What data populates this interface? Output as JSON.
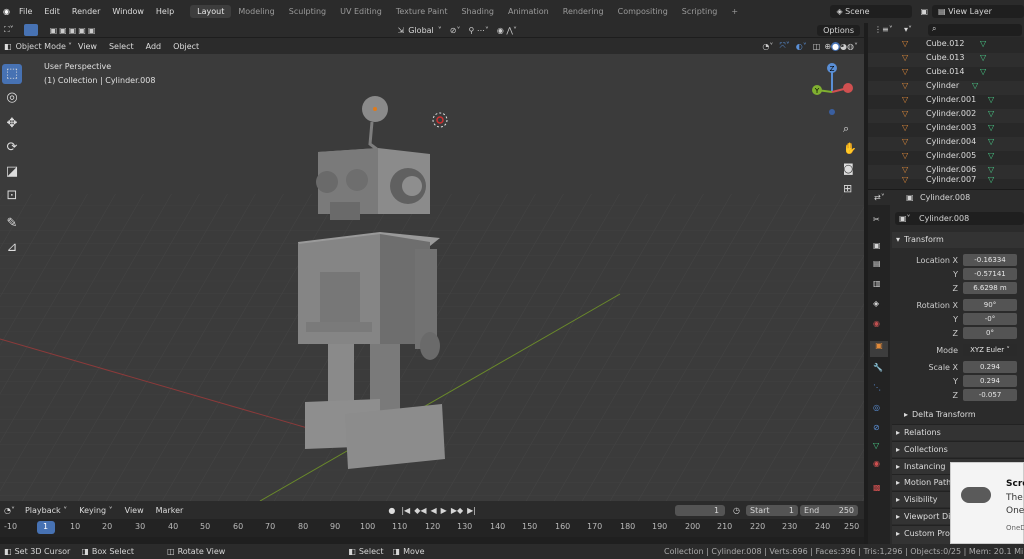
{
  "topbar": {
    "menus": [
      "File",
      "Edit",
      "Render",
      "Window",
      "Help"
    ],
    "workspaces": [
      "Layout",
      "Modeling",
      "Sculpting",
      "UV Editing",
      "Texture Paint",
      "Shading",
      "Animation",
      "Rendering",
      "Compositing",
      "Scripting"
    ],
    "active_workspace": "Layout",
    "add_tab": "+",
    "scene": "Scene",
    "view_layer": "View Layer"
  },
  "viewport_header": {
    "transform_orientation": "Global",
    "options": "Options",
    "mode": "Object Mode",
    "menus": [
      "View",
      "Select",
      "Add",
      "Object"
    ]
  },
  "viewport": {
    "perspective": "User Perspective",
    "collection_info": "(1) Collection | Cylinder.008",
    "gizmo_axes": [
      "Z",
      "Y",
      "X"
    ]
  },
  "outliner": {
    "items": [
      "Cube.012",
      "Cube.013",
      "Cube.014",
      "Cylinder",
      "Cylinder.001",
      "Cylinder.002",
      "Cylinder.003",
      "Cylinder.004",
      "Cylinder.005",
      "Cylinder.006",
      "Cylinder.007"
    ]
  },
  "properties": {
    "header_object": "Cylinder.008",
    "object_name": "Cylinder.008",
    "transform_label": "Transform",
    "location_label": "Location X",
    "location": [
      "-0.16334",
      "-0.57141",
      "6.6298 m"
    ],
    "rotation_label": "Rotation X",
    "rotation": [
      "90°",
      "-0°",
      "0°"
    ],
    "mode_label": "Mode",
    "rotation_mode": "XYZ Euler",
    "scale_label": "Scale X",
    "scale": [
      "0.294",
      "0.294",
      "-0.057"
    ],
    "axis_y": "Y",
    "axis_z": "Z",
    "sections": [
      "Delta Transform",
      "Relations",
      "Collections",
      "Instancing",
      "Motion Path",
      "Visibility",
      "Viewport Display",
      "Custom Properties"
    ]
  },
  "timeline": {
    "menus": [
      "Playback",
      "Keying",
      "View",
      "Marker"
    ],
    "current_frame": "1",
    "start_label": "Start",
    "start": "1",
    "end_label": "End",
    "end": "250",
    "ticks": [
      "-10",
      "1",
      "10",
      "20",
      "30",
      "40",
      "50",
      "60",
      "70",
      "80",
      "90",
      "100",
      "110",
      "120",
      "130",
      "140",
      "150",
      "160",
      "170",
      "180",
      "190",
      "200",
      "210",
      "220",
      "230",
      "240",
      "250"
    ]
  },
  "statusbar": {
    "set_cursor": "Set 3D Cursor",
    "box_select": "Box Select",
    "rotate_view": "Rotate View",
    "select": "Select",
    "move": "Move",
    "stats": "Collection | Cylinder.008 | Verts:696 | Faces:396 | Tris:1,296 | Objects:0/25 | Mem: 20.1 MiB | 2.83."
  },
  "notification": {
    "title": "Scre",
    "line1": "The",
    "line2": "One",
    "footer": "OneD"
  }
}
